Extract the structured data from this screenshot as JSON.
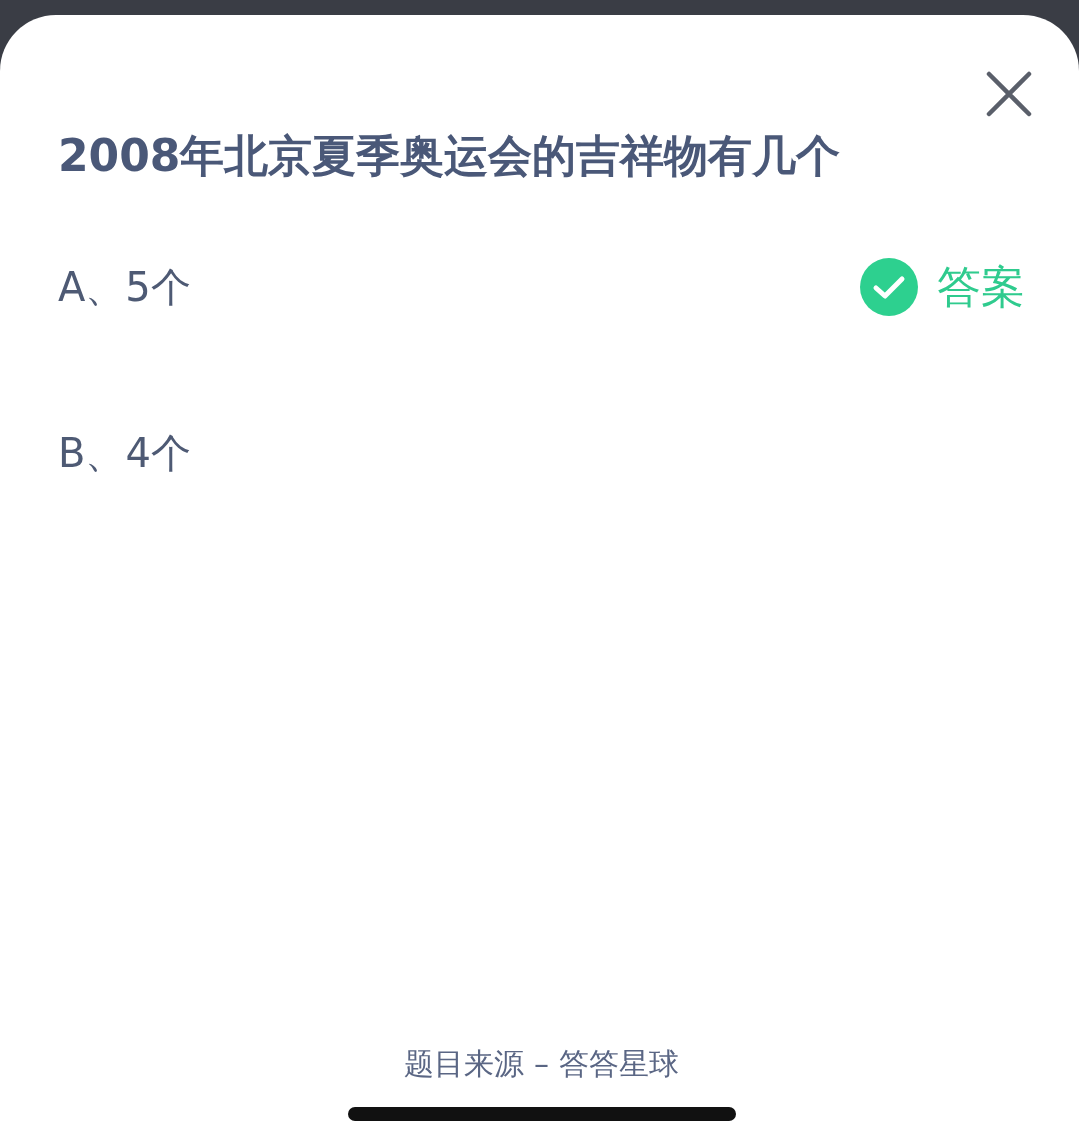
{
  "question": {
    "title": "2008年北京夏季奥运会的吉祥物有几个"
  },
  "options": [
    {
      "label": "A、5个",
      "correct": true,
      "answer_label": "答案"
    },
    {
      "label": "B、4个",
      "correct": false
    }
  ],
  "footer": "题目来源 – 答答星球"
}
